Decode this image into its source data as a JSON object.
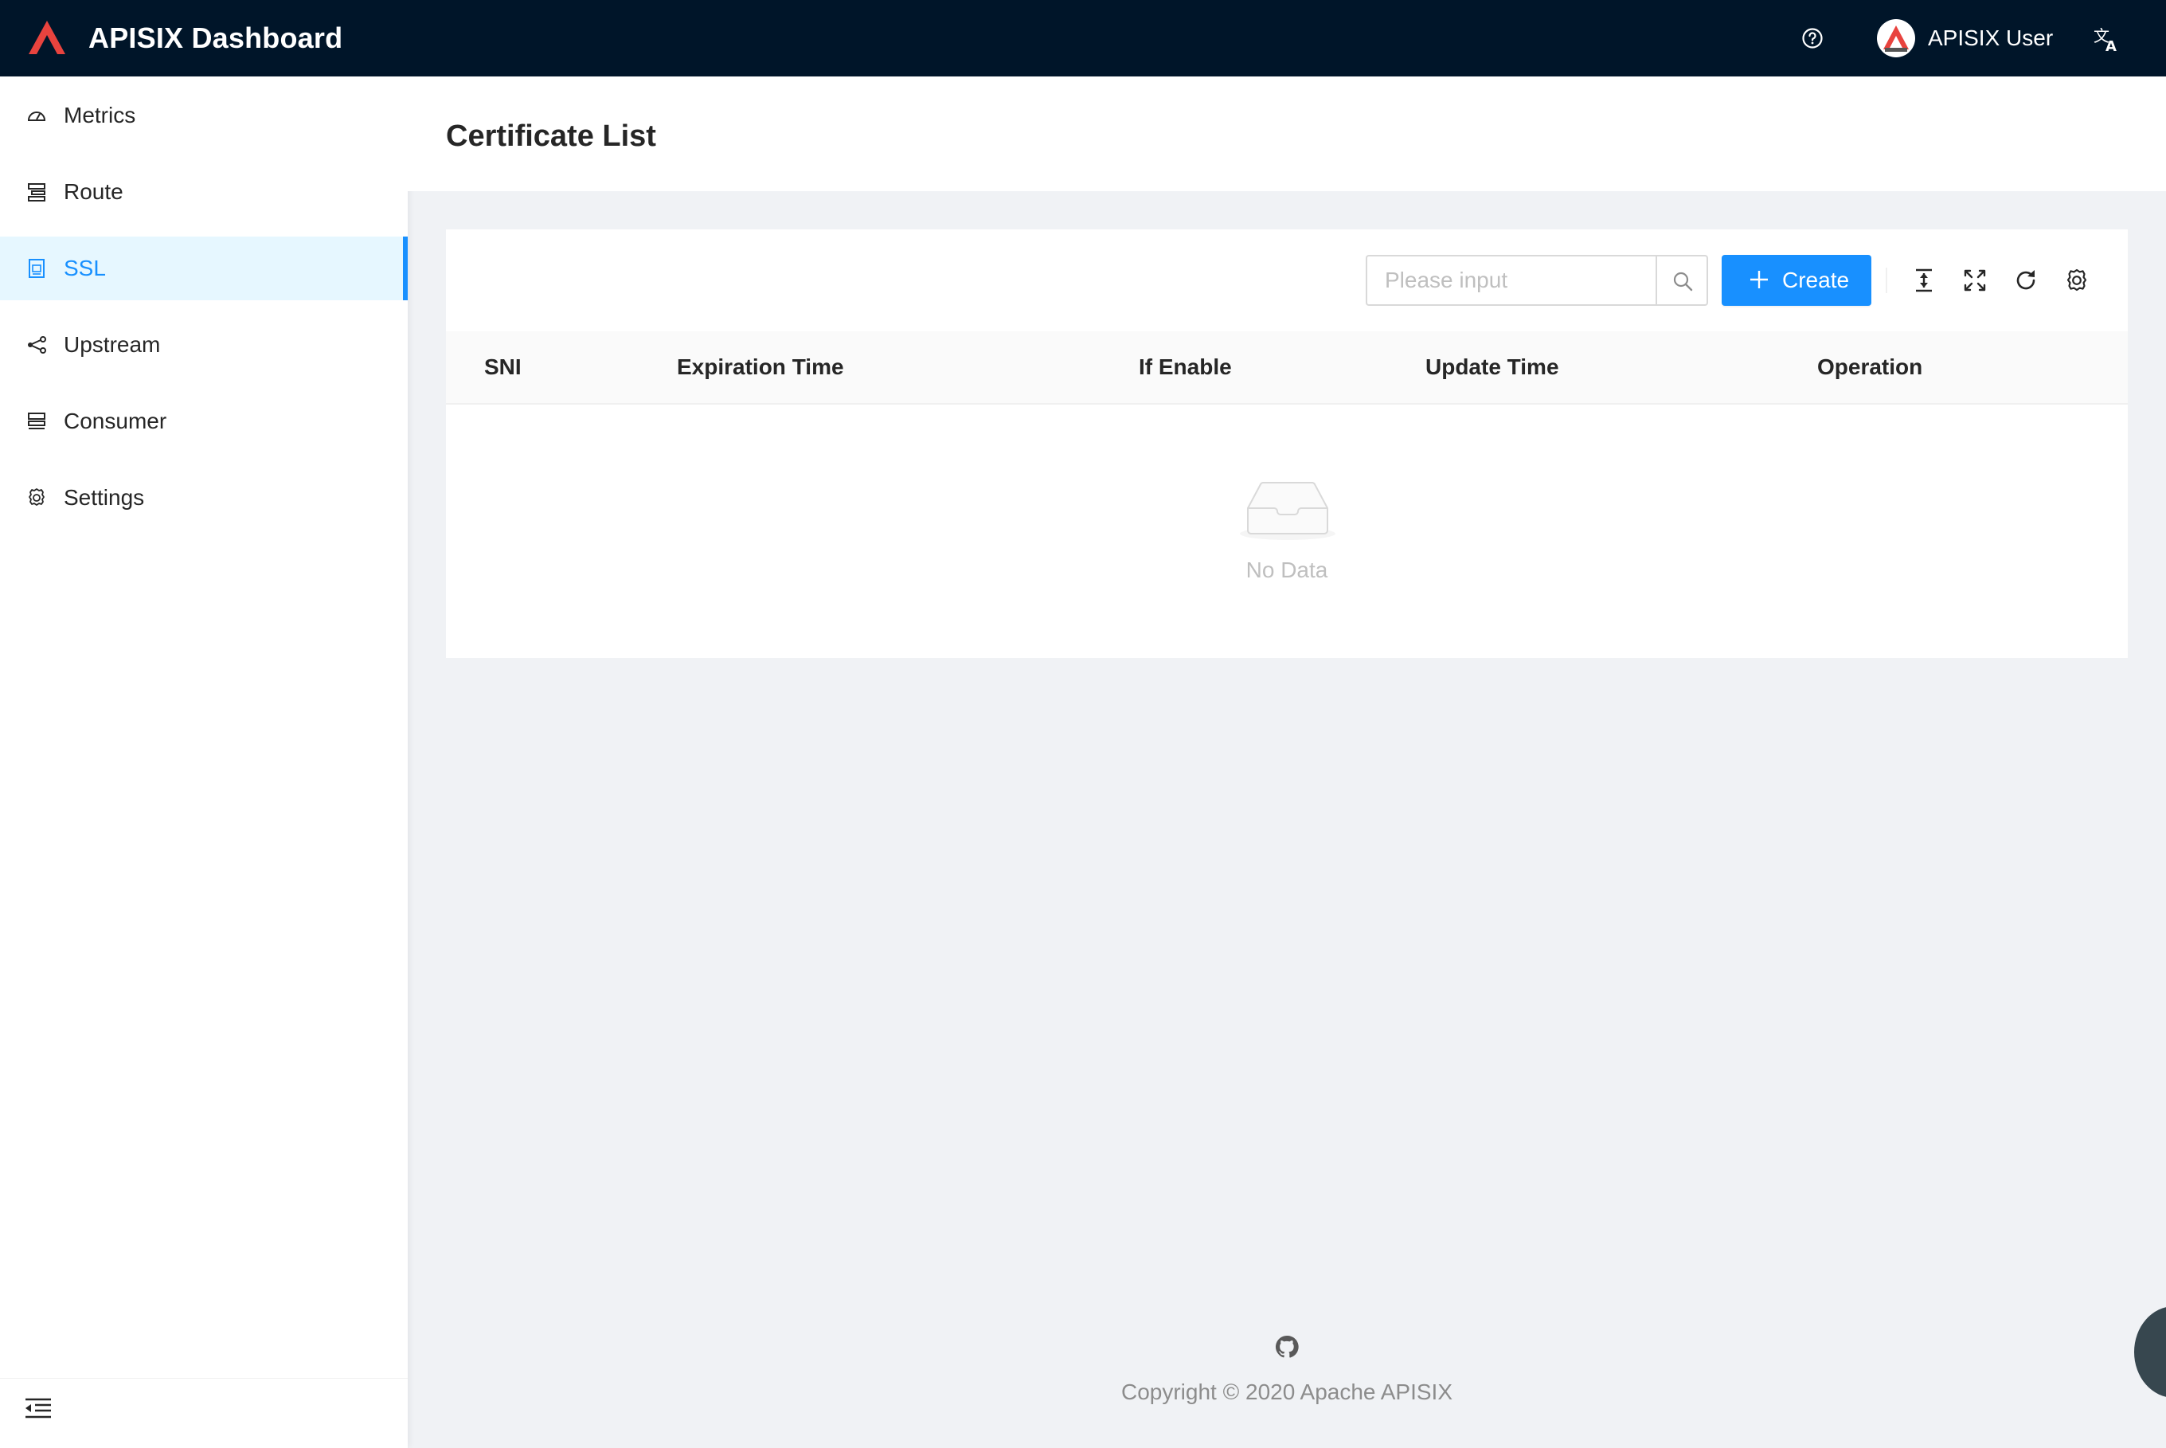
{
  "header": {
    "app_title": "APISIX Dashboard",
    "user_name": "APISIX User",
    "logo_color": "#e8433e",
    "icons": [
      "apisix-logo-icon",
      "question-circle-icon",
      "translation-icon"
    ]
  },
  "sidebar": {
    "items": [
      {
        "label": "Metrics",
        "icon": "dashboard-icon",
        "active": false
      },
      {
        "label": "Route",
        "icon": "route-icon",
        "active": false
      },
      {
        "label": "SSL",
        "icon": "ssl-icon",
        "active": true
      },
      {
        "label": "Upstream",
        "icon": "upstream-icon",
        "active": false
      },
      {
        "label": "Consumer",
        "icon": "consumer-icon",
        "active": false
      },
      {
        "label": "Settings",
        "icon": "gear-icon",
        "active": false
      }
    ],
    "collapse_icon": "menu-fold-icon",
    "accent_color": "#1890ff"
  },
  "page": {
    "title": "Certificate List"
  },
  "toolbar": {
    "search_placeholder": "Please input",
    "search_value": "",
    "create_label": "Create",
    "icons": [
      "column-height-icon",
      "fullscreen-icon",
      "reload-icon",
      "setting-icon"
    ]
  },
  "table": {
    "columns": [
      "SNI",
      "Expiration Time",
      "If Enable",
      "Update Time",
      "Operation"
    ],
    "rows": [],
    "empty_text": "No Data"
  },
  "footer": {
    "copyright": "Copyright © 2020 Apache APISIX",
    "icon": "github-icon"
  }
}
